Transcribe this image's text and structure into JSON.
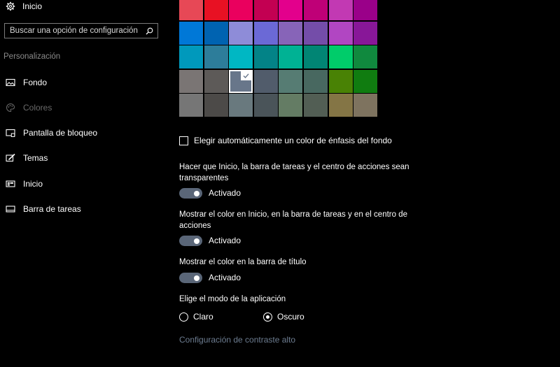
{
  "sidebar": {
    "home_label": "Inicio",
    "home_icon": "gear-icon",
    "search": {
      "placeholder": "Buscar una opción de configuración",
      "icon": "search-icon"
    },
    "section_title": "Personalización",
    "items": [
      {
        "label": "Fondo",
        "icon": "image-icon",
        "active": false
      },
      {
        "label": "Colores",
        "icon": "palette-icon",
        "active": true
      },
      {
        "label": "Pantalla de bloqueo",
        "icon": "lock-screen-icon",
        "active": false
      },
      {
        "label": "Temas",
        "icon": "brush-icon",
        "active": false
      },
      {
        "label": "Inicio",
        "icon": "start-icon",
        "active": false
      },
      {
        "label": "Barra de tareas",
        "icon": "taskbar-icon",
        "active": false
      }
    ]
  },
  "palette": {
    "rows": [
      [
        "#e74856",
        "#e81123",
        "#ea005e",
        "#c30052",
        "#e3008c",
        "#bf0077",
        "#c239b3",
        "#9a0089"
      ],
      [
        "#0078d7",
        "#0063b1",
        "#8e8cd8",
        "#6b69d6",
        "#8764b8",
        "#744da9",
        "#b146c2",
        "#881798"
      ],
      [
        "#0099bc",
        "#2d7d9a",
        "#00b7c3",
        "#038387",
        "#00b294",
        "#018574",
        "#00cc6a",
        "#10893e"
      ],
      [
        "#7a7574",
        "#5d5a58",
        "#68768a",
        "#515c6b",
        "#567c73",
        "#486860",
        "#498205",
        "#107c10"
      ],
      [
        "#767676",
        "#4c4a48",
        "#69797e",
        "#4a5459",
        "#647c64",
        "#525e54",
        "#847545",
        "#7e735f"
      ]
    ],
    "selected": {
      "row": 3,
      "col": 2
    }
  },
  "auto_color": {
    "label": "Elegir automáticamente un color de énfasis del fondo",
    "checked": false
  },
  "transparency": {
    "title": "Hacer que Inicio, la barra de tareas y el centro de acciones sean transparentes",
    "state": "Activado"
  },
  "show_color_start": {
    "title": "Mostrar el color en Inicio, en la barra de tareas y en el centro de acciones",
    "state": "Activado"
  },
  "show_color_titlebar": {
    "title": "Mostrar el color en la barra de título",
    "state": "Activado"
  },
  "app_mode": {
    "title": "Elige el modo de la aplicación",
    "options": [
      {
        "label": "Claro",
        "selected": false
      },
      {
        "label": "Oscuro",
        "selected": true
      }
    ]
  },
  "contrast_link": "Configuración de contraste alto",
  "colors": {
    "toggle_on": "#5a6678",
    "link": "#6d7d91",
    "dim_text": "#8a8a8a"
  }
}
